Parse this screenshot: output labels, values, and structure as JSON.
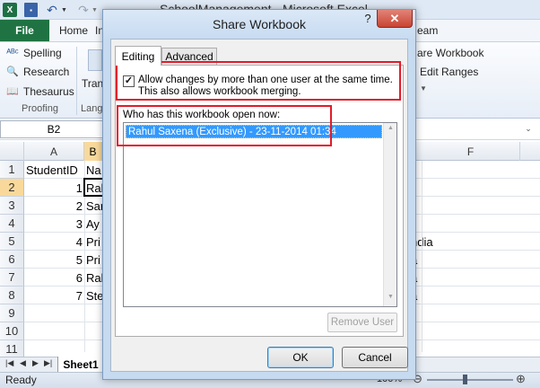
{
  "app": {
    "window_title": "SchoolManagement - Microsoft Excel",
    "qat": {
      "logo": "X",
      "save_icon": "save-icon",
      "undo_icon": "undo-icon",
      "redo_icon": "redo-icon"
    }
  },
  "ribbon": {
    "file_tab": "File",
    "tabs": [
      "Home",
      "In",
      "eam"
    ],
    "proofing": {
      "items": [
        {
          "label": "Spelling",
          "icon": "spelling-icon"
        },
        {
          "label": "Research",
          "icon": "research-icon"
        },
        {
          "label": "Thesaurus",
          "icon": "thesaurus-icon"
        }
      ],
      "group_label": "Proofing"
    },
    "language_partial": {
      "button_label": "Tran",
      "group_label": "Lang"
    },
    "changes_partial": {
      "share_label": "are Workbook",
      "track_label": "Edit Ranges"
    }
  },
  "formula_bar": {
    "name_box": "B2"
  },
  "grid": {
    "columns": [
      "A",
      "B",
      "F"
    ],
    "rows": [
      "1",
      "2",
      "3",
      "4",
      "5",
      "6",
      "7",
      "8",
      "9",
      "10",
      "11"
    ],
    "header_cell": "StudentID",
    "b1_partial": "Na",
    "ids": [
      "1",
      "2",
      "3",
      "4",
      "5",
      "6",
      "7"
    ],
    "names_partial": [
      "Ral",
      "Sar",
      "Ay",
      "Pri",
      "Pri",
      "Ral",
      "Ste"
    ],
    "right_partials": [
      "ndia",
      "a",
      "a",
      "a"
    ]
  },
  "sheets": {
    "active": "Sheet1"
  },
  "status": {
    "text": "Ready",
    "zoom": "100%",
    "zoom_level": 1.0
  },
  "dialog": {
    "title": "Share Workbook",
    "help": "?",
    "close": "✕",
    "tabs": [
      "Editing",
      "Advanced"
    ],
    "allow_changes": {
      "checked": true,
      "label": "Allow changes by more than one user at the same time.  This also allows workbook merging."
    },
    "who_label": "Who has this workbook open now:",
    "users": [
      "Rahul Saxena (Exclusive) - 23-11-2014 01:34"
    ],
    "remove_user": "Remove User",
    "ok": "OK",
    "cancel": "Cancel"
  }
}
